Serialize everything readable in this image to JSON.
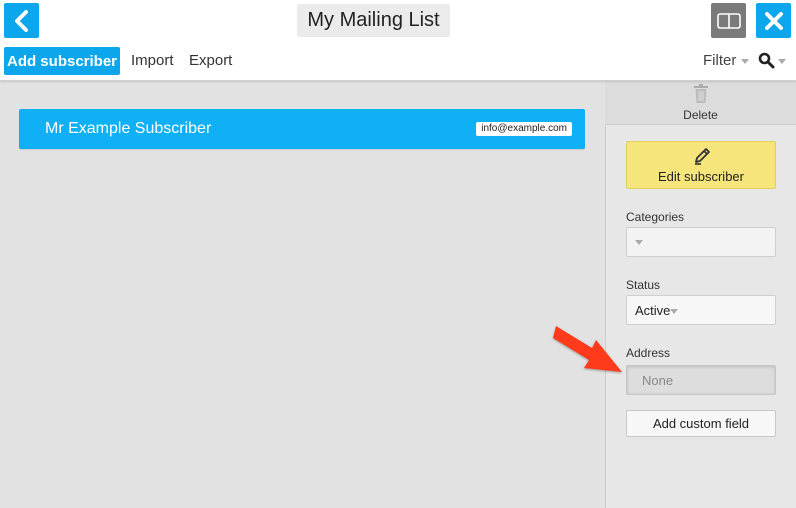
{
  "header": {
    "title": "My Mailing List",
    "back_icon": "chevron-left-icon",
    "split_icon": "split-view-icon",
    "close_icon": "close-icon",
    "accent_color": "#0ba6ec"
  },
  "toolbar": {
    "add_label": "Add subscriber",
    "import_label": "Import",
    "export_label": "Export",
    "filter_label": "Filter",
    "search_icon": "search-icon"
  },
  "subscribers": [
    {
      "name": "Mr Example Subscriber",
      "email": "info@example.com"
    }
  ],
  "panel": {
    "delete_label": "Delete",
    "edit_label": "Edit subscriber",
    "categories_label": "Categories",
    "categories_value": "",
    "status_label": "Status",
    "status_value": "Active",
    "address_label": "Address",
    "address_value": "None",
    "custom_field_label": "Add custom field",
    "edit_color": "#f6e57a"
  },
  "annotation": {
    "arrow_color": "#ff3b1f"
  }
}
